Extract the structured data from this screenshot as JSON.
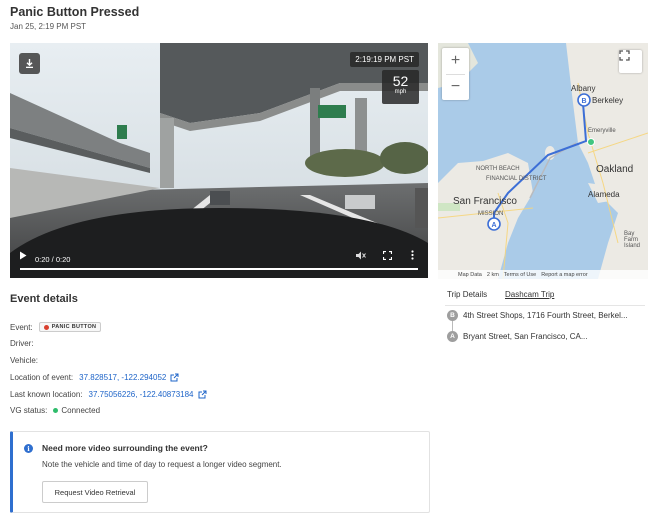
{
  "header": {
    "title": "Panic Button Pressed",
    "subtitle": "Jan 25, 2:19 PM PST"
  },
  "video": {
    "timestamp": "2:19:19 PM PST",
    "speed_value": "52",
    "speed_unit": "mph",
    "time_display": "0:20 / 0:20",
    "progress": 1.0
  },
  "map": {
    "labels": {
      "albany": "Albany",
      "berkeley": "Berkeley",
      "emeryville": "Emeryville",
      "oakland": "Oakland",
      "san_francisco": "San Francisco",
      "north_beach": "NORTH BEACH",
      "financial": "FINANCIAL DISTRICT",
      "mission": "MISSION",
      "alameda": "Alameda",
      "bay_farm": "Bay Farm Island"
    },
    "markers": {
      "start": "A",
      "end": "B"
    },
    "footer": {
      "map_data": "Map Data",
      "scale": "2 km",
      "terms": "Terms of Use",
      "report": "Report a map error"
    }
  },
  "tabs": {
    "trip_details": "Trip Details",
    "dashcam_trip": "Dashcam Trip"
  },
  "trip": {
    "stops": [
      {
        "marker": "B",
        "label": "4th Street Shops, 1716 Fourth Street, Berkel..."
      },
      {
        "marker": "A",
        "label": "Bryant Street, San Francisco, CA..."
      }
    ]
  },
  "event_details": {
    "heading": "Event details",
    "event_label": "Event:",
    "event_badge": "PANIC BUTTON",
    "driver_label": "Driver:",
    "vehicle_label": "Vehicle:",
    "location_label": "Location of event:",
    "location_value": "37.828517, -122.294052",
    "last_known_label": "Last known location:",
    "last_known_value": "37.75056226, -122.40873184",
    "vg_status_label": "VG status:",
    "vg_status_value": "Connected"
  },
  "info": {
    "heading": "Need more video surrounding the event?",
    "body": "Note the vehicle and time of day to request a longer video segment.",
    "button": "Request Video Retrieval"
  },
  "colors": {
    "accent": "#2f6fcf",
    "link": "#1e64c8",
    "panic_dot": "#d9402f",
    "connected_dot": "#2ebc6b",
    "route": "#3d6fd6"
  },
  "icons": {
    "download": "download-icon",
    "play": "play-icon",
    "mute": "volume-icon",
    "fullscreen": "fullscreen-icon",
    "more": "more-vertical-icon",
    "external": "external-link-icon",
    "info": "info-icon"
  }
}
